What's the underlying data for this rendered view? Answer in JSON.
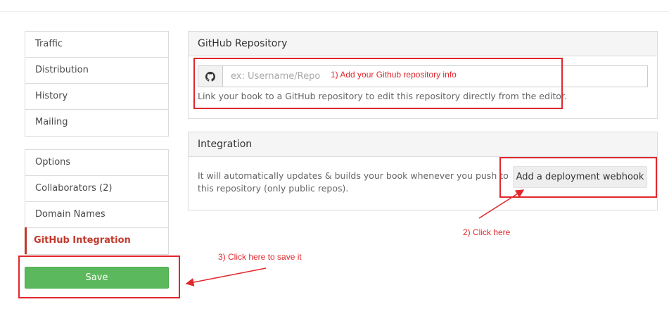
{
  "sidebar": {
    "group1": [
      {
        "label": "Traffic"
      },
      {
        "label": "Distribution"
      },
      {
        "label": "History"
      },
      {
        "label": "Mailing"
      }
    ],
    "group2": [
      {
        "label": "Options"
      },
      {
        "label": "Collaborators (2)"
      },
      {
        "label": "Domain Names"
      },
      {
        "label": "GitHub Integration",
        "active": true
      }
    ],
    "save_label": "Save"
  },
  "repo_panel": {
    "title": "GitHub Repository",
    "input_placeholder": "ex: Username/Repo",
    "input_value": "",
    "help": "Link your book to a GitHub repository to edit this repository directly from the editor.",
    "addon_icon": "github-icon"
  },
  "integration_panel": {
    "title": "Integration",
    "text": "It will automatically updates & builds your book whenever you push to this repository (only public repos).",
    "button_label": "Add a deployment webhook"
  },
  "annotations": {
    "step1": "1) Add your Github repository info",
    "step2": "2) Click here",
    "step3": "3) Click here to save it"
  },
  "colors": {
    "accent_active": "#c0392b",
    "save_green": "#5cb85c",
    "annotation_red": "#e0282d"
  }
}
